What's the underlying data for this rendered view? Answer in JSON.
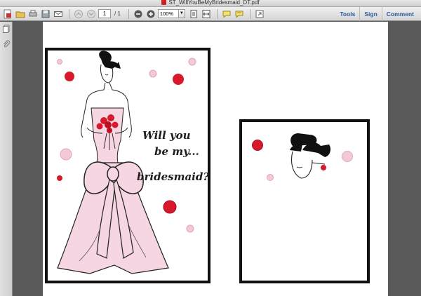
{
  "window": {
    "title": "ST_WillYouBeMyBridesmaid_DT.pdf"
  },
  "toolbar": {
    "page_current": "1",
    "page_total": "/ 1",
    "zoom": "100%",
    "menu": [
      "Tools",
      "Sign",
      "Comment"
    ]
  },
  "card": {
    "lines": [
      "Will you",
      "be my...",
      "bridesmaid?"
    ]
  },
  "colors": {
    "accent_red": "#d8182b",
    "pink_dress": "#f6d6e2",
    "pink_dot": "#f4c9d6",
    "menu_blue": "#2c5aa0"
  }
}
